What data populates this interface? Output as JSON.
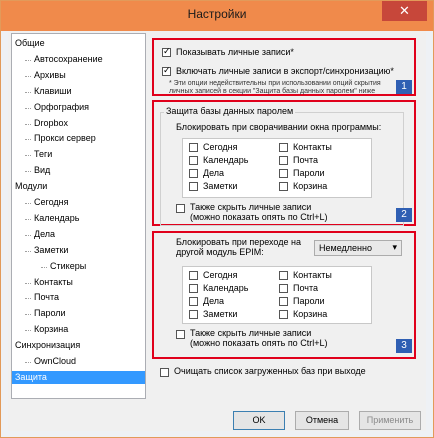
{
  "window": {
    "title": "Настройки",
    "close_glyph": "✕"
  },
  "tree": [
    {
      "label": "Общие",
      "level": 0
    },
    {
      "label": "Автосохранение",
      "level": 1
    },
    {
      "label": "Архивы",
      "level": 1
    },
    {
      "label": "Клавиши",
      "level": 1
    },
    {
      "label": "Орфография",
      "level": 1
    },
    {
      "label": "Dropbox",
      "level": 1
    },
    {
      "label": "Прокси сервер",
      "level": 1
    },
    {
      "label": "Теги",
      "level": 1
    },
    {
      "label": "Вид",
      "level": 1
    },
    {
      "label": "Модули",
      "level": 0
    },
    {
      "label": "Сегодня",
      "level": 1
    },
    {
      "label": "Календарь",
      "level": 1
    },
    {
      "label": "Дела",
      "level": 1
    },
    {
      "label": "Заметки",
      "level": 1
    },
    {
      "label": "Стикеры",
      "level": 2
    },
    {
      "label": "Контакты",
      "level": 1
    },
    {
      "label": "Почта",
      "level": 1
    },
    {
      "label": "Пароли",
      "level": 1
    },
    {
      "label": "Корзина",
      "level": 1
    },
    {
      "label": "Синхронизация",
      "level": 0
    },
    {
      "label": "OwnCloud",
      "level": 1
    },
    {
      "label": "Защита",
      "level": 0,
      "selected": true
    }
  ],
  "section1": {
    "show_private": "Показывать личные записи*",
    "include_private": "Включать личные записи в экспорт/синхронизацию*",
    "note_line1": "* Эти опции недействительны при использовании опций скрытия",
    "note_line2": "личных записей в секции \"Защита базы данных паролем\" ниже",
    "badge": "1"
  },
  "section2": {
    "group_title": "Защита базы данных паролем",
    "lock_label": "Блокировать при сворачивании окна программы:",
    "modules_left": [
      "Сегодня",
      "Календарь",
      "Дела",
      "Заметки"
    ],
    "modules_right": [
      "Контакты",
      "Почта",
      "Пароли",
      "Корзина"
    ],
    "hide_line1": "Также скрыть личные записи",
    "hide_line2": "(можно показать опять по Ctrl+L)",
    "badge": "2"
  },
  "section3": {
    "lock_line1": "Блокировать при переходе на",
    "lock_line2": "другой модуль EPIM:",
    "select_value": "Немедленно",
    "modules_left": [
      "Сегодня",
      "Календарь",
      "Дела",
      "Заметки"
    ],
    "modules_right": [
      "Контакты",
      "Почта",
      "Пароли",
      "Корзина"
    ],
    "hide_line1": "Также скрыть личные записи",
    "hide_line2": "(можно показать опять по Ctrl+L)",
    "badge": "3"
  },
  "clear_list": "Очищать список загруженных баз при выходе",
  "buttons": {
    "ok": "OK",
    "cancel": "Отмена",
    "apply": "Применить"
  }
}
